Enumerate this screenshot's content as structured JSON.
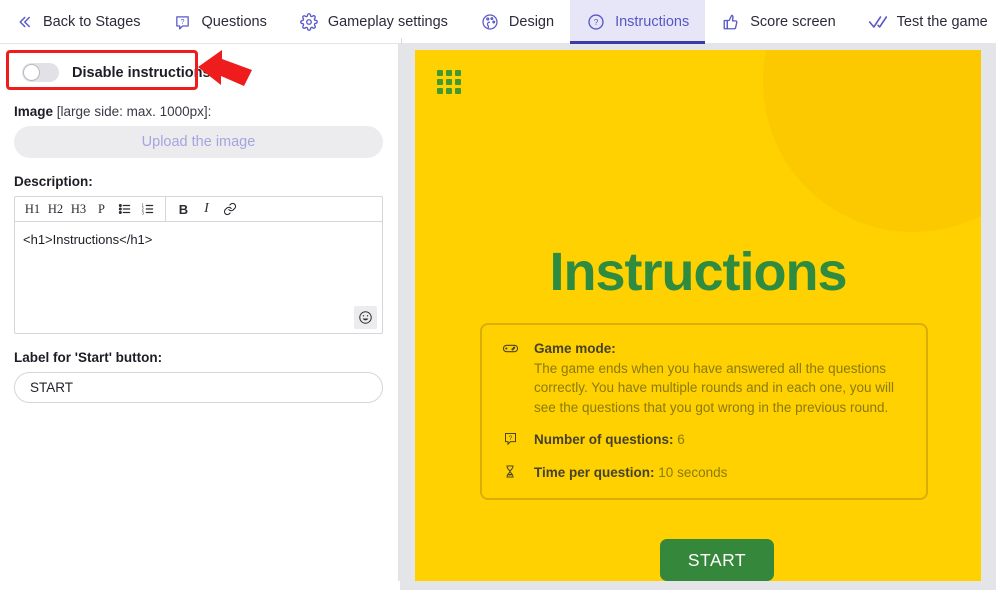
{
  "topnav": {
    "items": [
      {
        "label": "Back to Stages",
        "icon": "double-chevron-left-icon",
        "active": false
      },
      {
        "label": "Questions",
        "icon": "question-bubble-icon",
        "active": false
      },
      {
        "label": "Gameplay settings",
        "icon": "gear-icon",
        "active": false
      },
      {
        "label": "Design",
        "icon": "palette-icon",
        "active": false
      },
      {
        "label": "Instructions",
        "icon": "question-circle-icon",
        "active": true
      },
      {
        "label": "Score screen",
        "icon": "thumbs-up-icon",
        "active": false
      },
      {
        "label": "Test the game",
        "icon": "check-double-icon",
        "active": false
      }
    ],
    "accent_color": "#5856c4",
    "active_bg": "#e7e6f8",
    "active_underline": "#3b38a8"
  },
  "sidebar": {
    "toggle": {
      "label": "Disable instructions",
      "state": "off"
    },
    "image": {
      "label_bold": "Image",
      "label_light": "[large side: max. 1000px]:",
      "upload_button": "Upload the image"
    },
    "description": {
      "label": "Description:",
      "toolbar": [
        "H1",
        "H2",
        "H3",
        "P",
        "bulleted-list-icon",
        "numbered-list-icon",
        "B",
        "I",
        "link-icon"
      ],
      "content": "<h1>Instructions</h1>",
      "emoji_button": "emoji-picker-icon"
    },
    "start_label_field": {
      "label": "Label for 'Start' button:",
      "value": "START"
    },
    "annotation": {
      "box_color": "#ee1c1c",
      "arrow_color": "#ee1c1c"
    }
  },
  "preview": {
    "background_color": "#FFD100",
    "grid_icon": "grid-menu-icon",
    "title": "Instructions",
    "title_color": "#2e8b40",
    "card": {
      "rows": [
        {
          "icon": "gamepad-icon",
          "heading": "Game mode:",
          "body": "The game ends when you have answered all the questions correctly. You have multiple rounds and in each one, you will see the questions that you got wrong in the previous round."
        },
        {
          "icon": "question-bubble-icon",
          "heading": "Number of questions:",
          "value": "6"
        },
        {
          "icon": "hourglass-icon",
          "heading": "Time per question:",
          "value": "10 seconds"
        }
      ]
    },
    "start_button": {
      "label": "START",
      "color": "#35883b"
    }
  }
}
